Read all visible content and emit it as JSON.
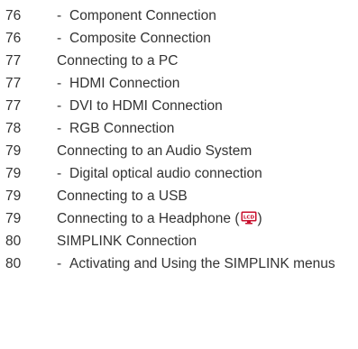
{
  "toc": {
    "entries": [
      {
        "page": "76",
        "sub": true,
        "title": "Component Connection"
      },
      {
        "page": "76",
        "sub": true,
        "title": "Composite Connection"
      },
      {
        "page": "77",
        "sub": false,
        "title": "Connecting to a PC"
      },
      {
        "page": "77",
        "sub": true,
        "title": "HDMI Connection"
      },
      {
        "page": "77",
        "sub": true,
        "title": "DVI to HDMI Connection"
      },
      {
        "page": "78",
        "sub": true,
        "title": "RGB Connection"
      },
      {
        "page": "79",
        "sub": false,
        "title": "Connecting to an Audio System"
      },
      {
        "page": "79",
        "sub": true,
        "title": "Digital optical audio connection"
      },
      {
        "page": "79",
        "sub": false,
        "title": "Connecting to a USB"
      },
      {
        "page": "79",
        "sub": false,
        "title": "Connecting to a Headphone (",
        "badge": "LCD",
        "suffix": ")"
      },
      {
        "page": "80",
        "sub": false,
        "title": "SIMPLINK Connection"
      },
      {
        "page": "80",
        "sub": true,
        "title": "Activating and Using the SIMPLINK menus"
      }
    ],
    "dash": "-",
    "badge_color": "#c8102e"
  }
}
